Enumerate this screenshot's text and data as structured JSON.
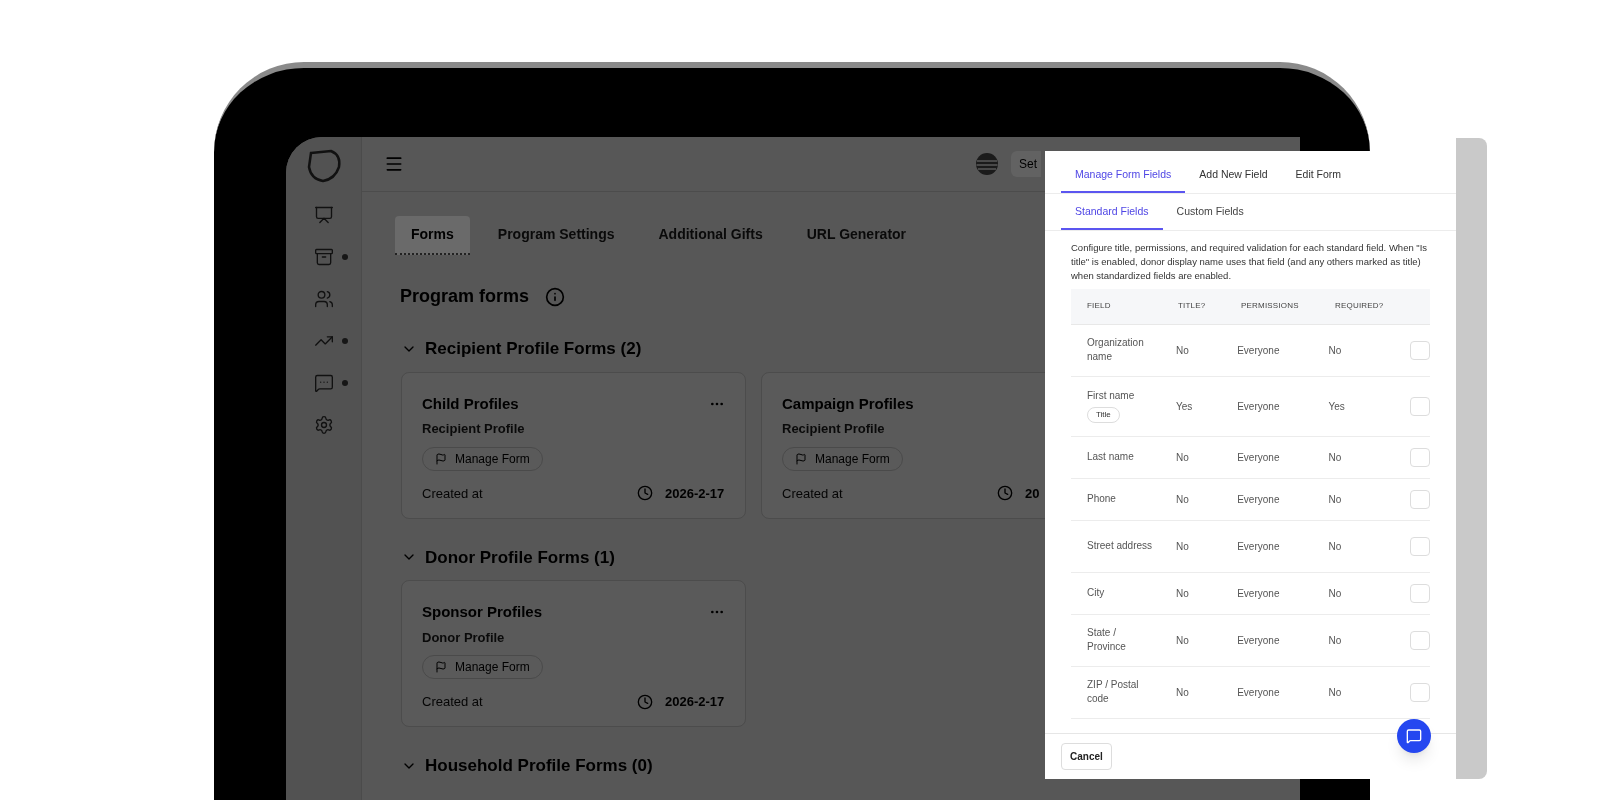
{
  "sidebar": {
    "items": [
      {
        "kind": "presentation",
        "dot": false
      },
      {
        "kind": "drawer",
        "dot": true
      },
      {
        "kind": "people",
        "dot": false
      },
      {
        "kind": "trend",
        "dot": true
      },
      {
        "kind": "chat",
        "dot": true
      },
      {
        "kind": "settings",
        "dot": false
      }
    ]
  },
  "header": {
    "action": "Set"
  },
  "tabs": [
    {
      "label": "Forms",
      "selected": true
    },
    {
      "label": "Program Settings",
      "selected": false
    },
    {
      "label": "Additional Gifts",
      "selected": false
    },
    {
      "label": "URL Generator",
      "selected": false
    }
  ],
  "page_title": "Program forms",
  "groups": [
    {
      "title": "Recipient Profile Forms (2)",
      "cards": [
        {
          "title": "Child Profiles",
          "subtitle": "Recipient Profile",
          "menu": true,
          "action": "Manage Form",
          "created_label": "Created at",
          "date": "2026-2-17"
        },
        {
          "title": "Campaign Profiles",
          "subtitle": "Recipient Profile",
          "menu": false,
          "action": "Manage Form",
          "created_label": "Created at",
          "date": "20"
        }
      ]
    },
    {
      "title": "Donor Profile Forms (1)",
      "cards": [
        {
          "title": "Sponsor Profiles",
          "subtitle": "Donor Profile",
          "menu": true,
          "action": "Manage Form",
          "created_label": "Created at",
          "date": "2026-2-17"
        }
      ]
    },
    {
      "title": "Household Profile Forms (0)"
    }
  ],
  "modal": {
    "tabs": [
      {
        "label": "Manage Form Fields",
        "selected": true
      },
      {
        "label": "Add New Field",
        "selected": false
      },
      {
        "label": "Edit Form",
        "selected": false
      }
    ],
    "subtabs": [
      {
        "label": "Standard Fields",
        "selected": true
      },
      {
        "label": "Custom Fields",
        "selected": false
      }
    ],
    "description": "Configure title, permissions, and required validation for each standard field. When \"Is title\" is enabled, donor display name uses that field (and any others marked as title) when standardized fields are enabled.",
    "columns": [
      "FIELD",
      "TITLE?",
      "PERMISSIONS",
      "REQUIRED?"
    ],
    "rows": [
      {
        "field": "Organization name",
        "title": "No",
        "permissions": "Everyone",
        "required": "No"
      },
      {
        "field": "First name",
        "badge": "Title",
        "title": "Yes",
        "permissions": "Everyone",
        "required": "Yes"
      },
      {
        "field": "Last name",
        "title": "No",
        "permissions": "Everyone",
        "required": "No"
      },
      {
        "field": "Phone",
        "title": "No",
        "permissions": "Everyone",
        "required": "No"
      },
      {
        "field": "Street address",
        "title": "No",
        "permissions": "Everyone",
        "required": "No"
      },
      {
        "field": "City",
        "title": "No",
        "permissions": "Everyone",
        "required": "No"
      },
      {
        "field": "State / Province",
        "title": "No",
        "permissions": "Everyone",
        "required": "No"
      },
      {
        "field": "ZIP / Postal code",
        "title": "No",
        "permissions": "Everyone",
        "required": "No"
      }
    ],
    "cancel": "Cancel"
  }
}
